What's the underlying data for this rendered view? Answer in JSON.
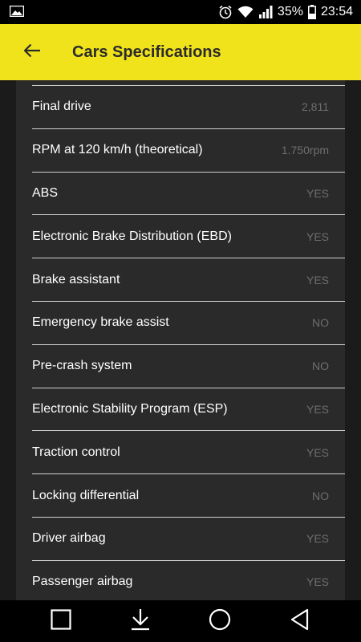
{
  "status_bar": {
    "battery_percent": "35%",
    "time": "23:54",
    "icons": [
      "gallery-icon",
      "alarm-icon",
      "wifi-icon",
      "signal-icon",
      "battery-icon"
    ]
  },
  "app_bar": {
    "title": "Cars Specifications",
    "back_icon": "arrow-left-icon",
    "background_color": "#f0e31b"
  },
  "specs": [
    {
      "label": "Final drive",
      "value": "2,811"
    },
    {
      "label": "RPM at 120 km/h (theoretical)",
      "value": "1.750rpm"
    },
    {
      "label": "ABS",
      "value": "YES"
    },
    {
      "label": "Electronic Brake Distribution (EBD)",
      "value": "YES"
    },
    {
      "label": "Brake assistant",
      "value": "YES"
    },
    {
      "label": "Emergency brake assist",
      "value": "NO"
    },
    {
      "label": "Pre-crash system",
      "value": "NO"
    },
    {
      "label": "Electronic Stability Program (ESP)",
      "value": "YES"
    },
    {
      "label": "Traction control",
      "value": "YES"
    },
    {
      "label": "Locking differential",
      "value": "NO"
    },
    {
      "label": "Driver airbag",
      "value": "YES"
    },
    {
      "label": "Passenger airbag",
      "value": "YES"
    }
  ],
  "nav_bar": {
    "buttons": [
      "recent-apps-icon",
      "download-icon",
      "home-icon",
      "back-icon"
    ]
  }
}
